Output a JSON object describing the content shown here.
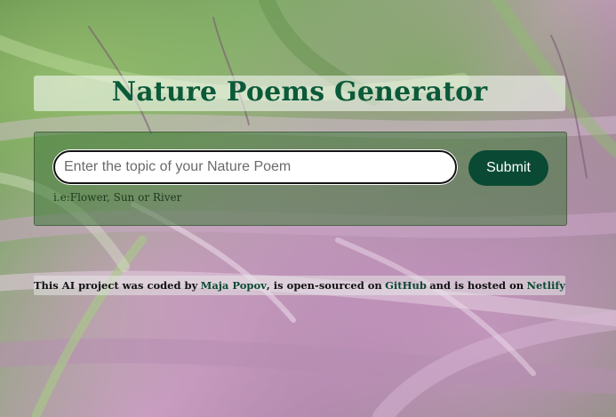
{
  "header": {
    "title": "Nature Poems Generator"
  },
  "form": {
    "input_placeholder": "Enter the topic of your Nature Poem",
    "submit_label": "Submit",
    "hint": "i.e:Flower, Sun or River"
  },
  "footer": {
    "prefix": "This AI project was coded by",
    "author_link": "Maja Popov",
    "middle": ", is open-sourced on",
    "github_link": "GitHub",
    "and_text": "and is hosted on",
    "netlify_link": "Netlify"
  },
  "colors": {
    "title": "#0b5a3a",
    "submit_bg": "#0a4a34",
    "panel_bg": "#41783c"
  }
}
